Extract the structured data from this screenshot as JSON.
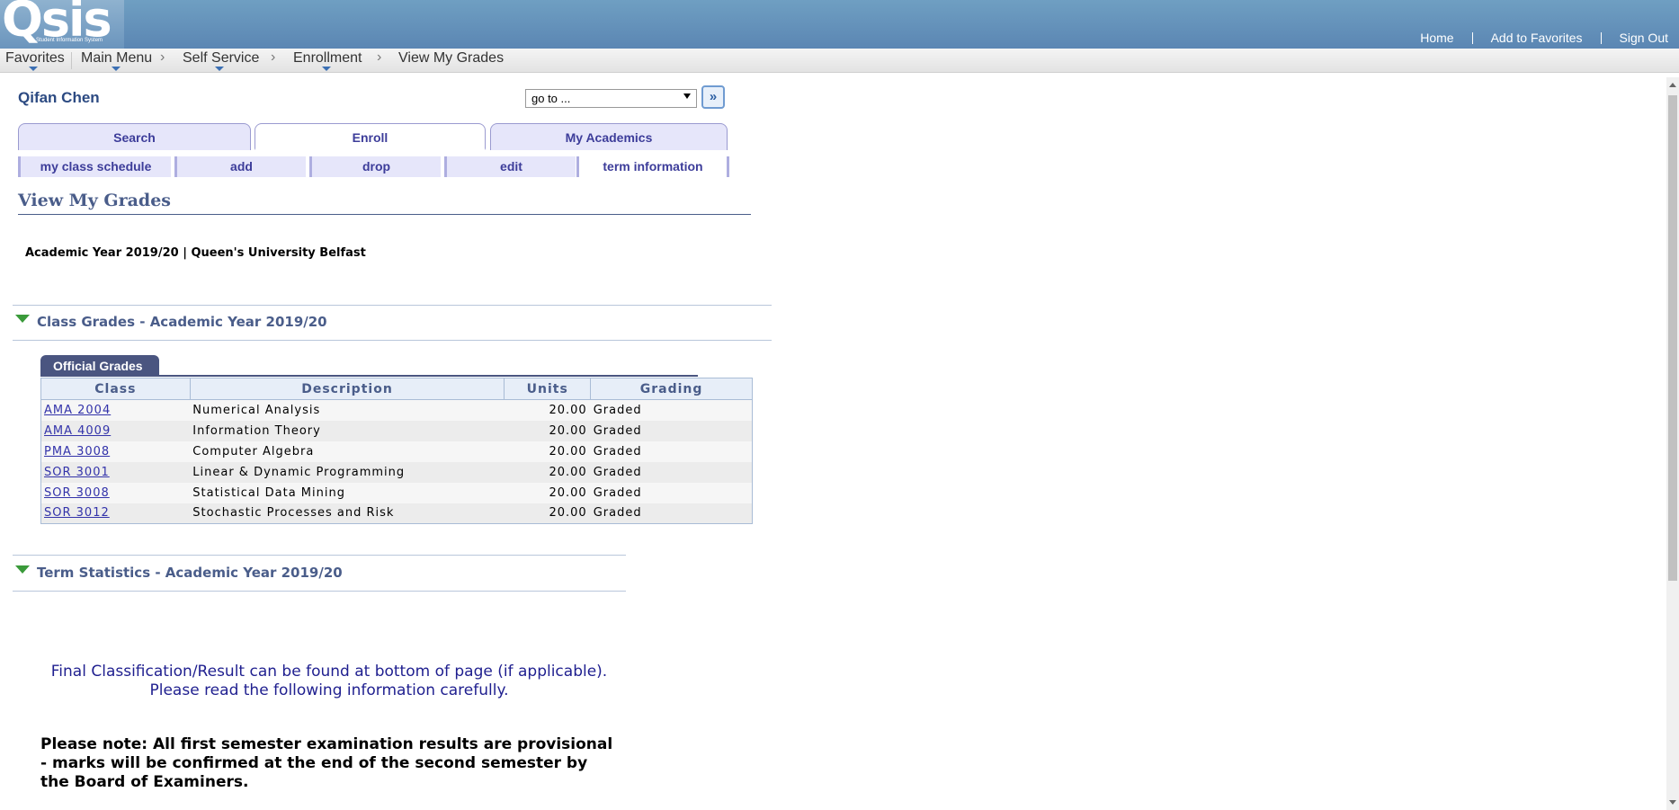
{
  "header": {
    "logo_text": "Qsis",
    "logo_subtitle": "Student Information System",
    "links": [
      "Home",
      "Add to Favorites",
      "Sign Out"
    ]
  },
  "nav": {
    "favorites": "Favorites",
    "main_menu": "Main Menu",
    "breadcrumb": [
      "Self Service",
      "Enrollment",
      "View My Grades"
    ],
    "separator": "›"
  },
  "student": {
    "name": "Qifan Chen"
  },
  "goto": {
    "value": "go to ...",
    "button_icon": "double-chevron-right-icon",
    "button_glyph": "»"
  },
  "main_tabs": [
    {
      "label": "Search"
    },
    {
      "label": "Enroll",
      "active": true
    },
    {
      "label": "My Academics"
    }
  ],
  "sub_tabs": [
    {
      "label": "my class schedule"
    },
    {
      "label": "add"
    },
    {
      "label": "drop"
    },
    {
      "label": "edit"
    },
    {
      "label": "term information",
      "active": true
    }
  ],
  "page_title": "View My Grades",
  "academic_info": "Academic Year 2019/20 | Queen's University Belfast",
  "class_grades": {
    "header": "Class Grades - Academic Year 2019/20",
    "tab_label": "Official Grades",
    "columns": [
      "Class",
      "Description",
      "Units",
      "Grading"
    ],
    "rows": [
      {
        "class": "AMA 2004",
        "description": "Numerical Analysis",
        "units": "20.00",
        "grading": "Graded"
      },
      {
        "class": "AMA 4009",
        "description": "Information Theory",
        "units": "20.00",
        "grading": "Graded"
      },
      {
        "class": "PMA 3008",
        "description": "Computer Algebra",
        "units": "20.00",
        "grading": "Graded"
      },
      {
        "class": "SOR 3001",
        "description": "Linear & Dynamic Programming",
        "units": "20.00",
        "grading": "Graded"
      },
      {
        "class": "SOR 3008",
        "description": "Statistical Data Mining",
        "units": "20.00",
        "grading": "Graded"
      },
      {
        "class": "SOR 3012",
        "description": "Stochastic Processes and Risk",
        "units": "20.00",
        "grading": "Graded"
      }
    ]
  },
  "term_statistics": {
    "header": "Term Statistics - Academic Year 2019/20"
  },
  "info": {
    "line1": "Final Classification/Result can be found at bottom of page (if applicable).",
    "line2": "Please read the following information carefully.",
    "note": "Please note: All first semester examination results are provisional - marks will be confirmed at the end of the second semester by the Board of Examiners."
  },
  "colors": {
    "banner": "#5b86b3",
    "tab_text": "#3d3d9a",
    "section_header": "#4a5d8a",
    "link": "#3333aa",
    "info_blue": "#1f1f8f",
    "expand_icon": "#3a9a3a"
  }
}
